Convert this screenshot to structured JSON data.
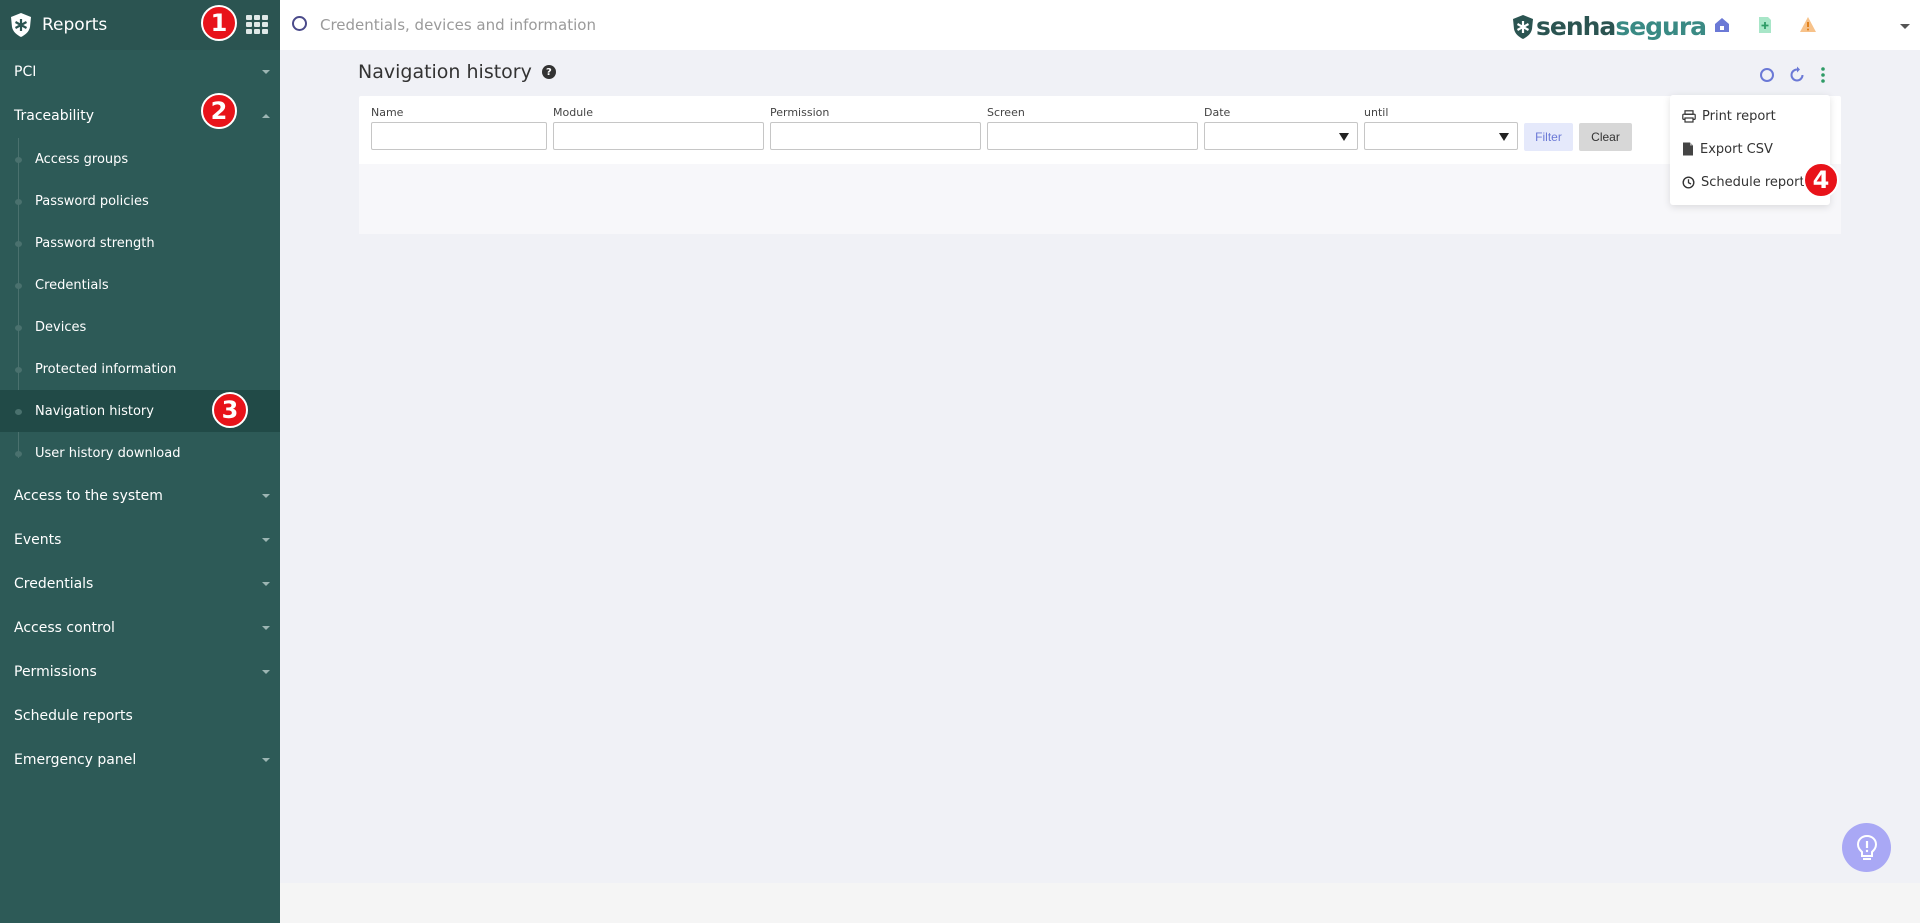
{
  "sidebar": {
    "title": "Reports",
    "groups_top": [
      {
        "label": "PCI"
      },
      {
        "label": "Traceability"
      }
    ],
    "traceability_items": [
      {
        "label": "Access groups"
      },
      {
        "label": "Password policies"
      },
      {
        "label": "Password strength"
      },
      {
        "label": "Credentials"
      },
      {
        "label": "Devices"
      },
      {
        "label": "Protected information"
      },
      {
        "label": "Navigation history"
      },
      {
        "label": "User history download"
      }
    ],
    "groups_bottom": [
      {
        "label": "Access to the system"
      },
      {
        "label": "Events"
      },
      {
        "label": "Credentials"
      },
      {
        "label": "Access control"
      },
      {
        "label": "Permissions"
      },
      {
        "label": "Schedule reports"
      },
      {
        "label": "Emergency panel"
      }
    ]
  },
  "topbar": {
    "search_placeholder": "Credentials, devices and information",
    "brand_part1": "senha",
    "brand_part2": "segura"
  },
  "page": {
    "title": "Navigation history"
  },
  "filters": {
    "fields": [
      {
        "label": "Name"
      },
      {
        "label": "Module"
      },
      {
        "label": "Permission"
      },
      {
        "label": "Screen"
      },
      {
        "label": "Date"
      },
      {
        "label": "until"
      }
    ],
    "filter_button": "Filter",
    "clear_button": "Clear"
  },
  "actions_menu": {
    "items": [
      {
        "label": "Print report"
      },
      {
        "label": "Export CSV"
      },
      {
        "label": "Schedule report"
      }
    ]
  },
  "badges": [
    "1",
    "2",
    "3",
    "4"
  ],
  "colors": {
    "sidebar_bg": "#2d5a57",
    "sidebar_active": "#214a47",
    "brand": "#2b5451",
    "accent": "#6b79d6",
    "badge": "#e8131a"
  }
}
